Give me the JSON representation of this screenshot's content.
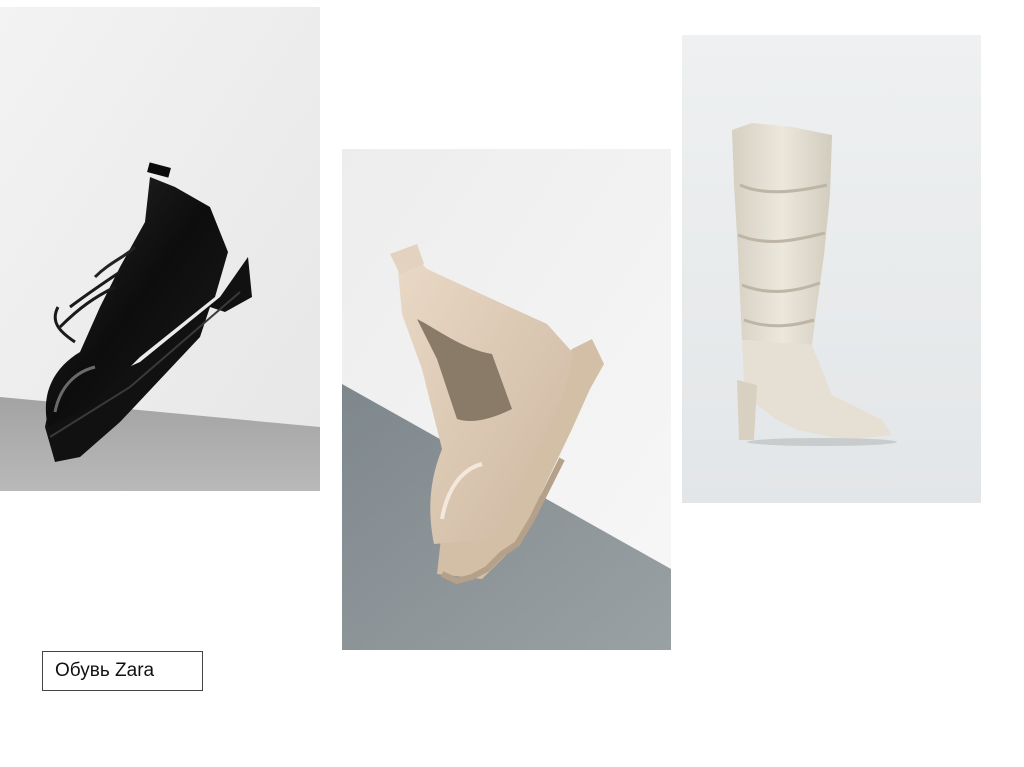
{
  "slide": {
    "caption": "Обувь Zara"
  },
  "images": [
    {
      "subject": "black-oxford-shoe"
    },
    {
      "subject": "beige-chelsea-boot"
    },
    {
      "subject": "cream-slouch-knee-boot"
    }
  ],
  "colors": {
    "background": "#ffffff",
    "caption_border": "#444444",
    "oxford_leather": "#121212",
    "chelsea_leather": "#d9c6b2",
    "knee_boot_leather": "#e4ded2",
    "floor_grey": "#8e9497",
    "wall_grey": "#eeeeee"
  }
}
